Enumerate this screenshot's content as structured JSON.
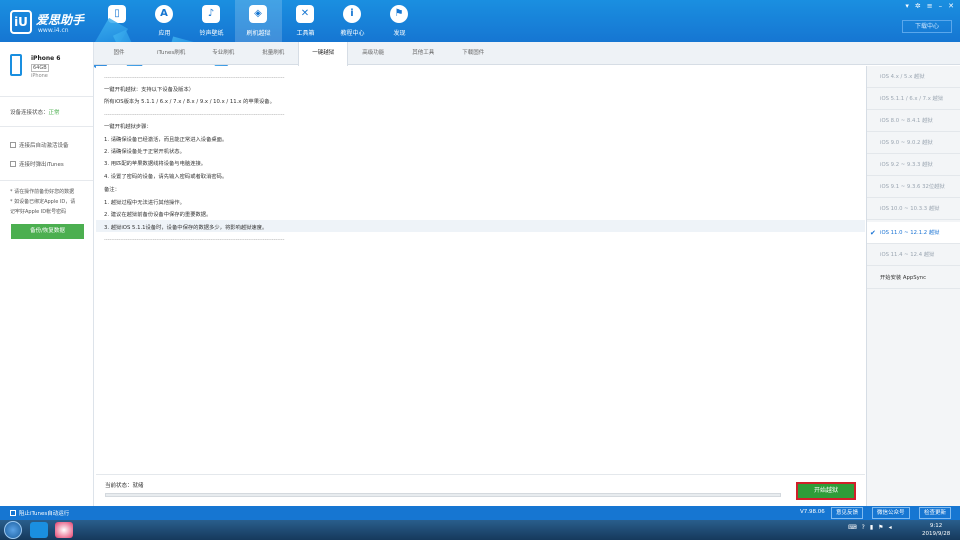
{
  "app": {
    "logo_text": "爱思助手",
    "logo_sub": "www.i4.cn",
    "nav": [
      {
        "label": "",
        "icon": "phone-icon"
      },
      {
        "label": "应用",
        "icon": "app-store-icon"
      },
      {
        "label": "铃声壁纸",
        "icon": "ringtone-icon"
      },
      {
        "label": "刷机越狱",
        "icon": "box-icon"
      },
      {
        "label": "工具箱",
        "icon": "toolbox-icon"
      },
      {
        "label": "教程中心",
        "icon": "info-icon"
      },
      {
        "label": "发现",
        "icon": "flag-icon"
      }
    ],
    "download_center": "下载中心"
  },
  "device": {
    "name": "iPhone 6",
    "capacity": "64GB",
    "type": "iPhone",
    "connection_label": "设备连接状态：",
    "connection_value": "正常",
    "check1": "连接后自动激活设备",
    "check2": "连接时弹出iTunes",
    "note1": "* 请在操作前备份好您的数据",
    "note2": "* 如设备已绑定Apple ID，请",
    "note3": "  记牢好Apple ID帐号密码",
    "backup_btn": "备份/恢复数据"
  },
  "tabs": [
    "固件",
    "iTunes刷机",
    "专业刷机",
    "批量刷机",
    "一键越狱",
    "高级功能",
    "其他工具",
    "下载固件"
  ],
  "content": {
    "dash": "----------------------------------------------------------------------------------------------------",
    "l1": "一键开机越狱：支持以下设备及版本）",
    "l2": "所有iOS版本为 5.1.1 / 6.x / 7.x / 8.x / 9.x / 10.x / 11.x 的苹果设备。",
    "l3": "一键开机越狱步骤：",
    "s1": "1.  请确保设备已经激活，而且能正常进入设备桌面。",
    "s2": "2.  请确保设备处于正常开机状态。",
    "s3": "3.  用匹配的苹果数据线将设备与电脑连接。",
    "s4": "4.  设置了密码的设备，请先输入密码或者取消密码。",
    "note": "备注：",
    "n1": "1.  越狱过程中无法进行其他操作。",
    "n2": "2.  建议在越狱前备份设备中保存的重要数据。",
    "n3": "3.  越狱iOS 5.1.1设备时，设备中保存的数据多少，将影响越狱速度。"
  },
  "status": {
    "text": "当前状态：就绪",
    "start_btn": "开始越狱",
    "progress": 0
  },
  "ios_list": [
    {
      "label": "iOS 4.x / 5.x 越狱",
      "selected": false
    },
    {
      "label": "iOS 5.1.1 / 6.x / 7.x 越狱",
      "selected": false
    },
    {
      "label": "iOS 8.0 ~ 8.4.1 越狱",
      "selected": false
    },
    {
      "label": "iOS 9.0 ~ 9.0.2 越狱",
      "selected": false
    },
    {
      "label": "iOS 9.2 ~ 9.3.3 越狱",
      "selected": false
    },
    {
      "label": "iOS 9.1 ~ 9.3.6 32位越狱",
      "selected": false
    },
    {
      "label": "iOS 10.0 ~ 10.3.3 越狱",
      "selected": false
    },
    {
      "label": "iOS 11.0 ~ 12.1.2 越狱",
      "selected": true
    },
    {
      "label": "iOS 11.4 ~ 12.4 越狱",
      "selected": false
    },
    {
      "label": "开始安装 AppSync",
      "selected": false
    }
  ],
  "footer": {
    "itunes_label": "阻止iTunes自动运行",
    "version": "V7.98.06",
    "feedback": "意见反馈",
    "wechat": "微信公众号",
    "update": "检查更新"
  },
  "taskbar": {
    "time": "9:12",
    "date": "2019/9/28"
  }
}
